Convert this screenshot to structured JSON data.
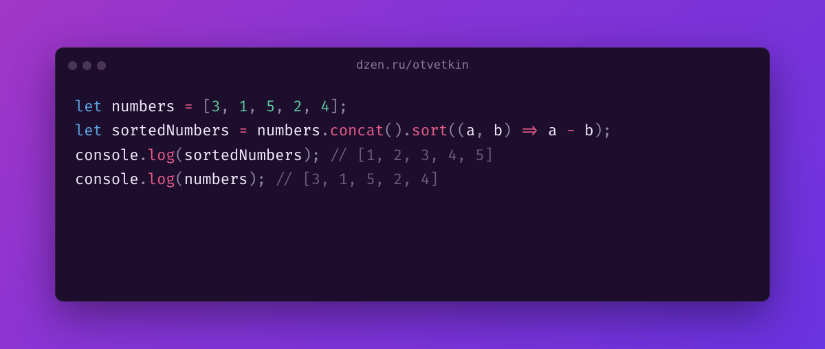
{
  "window": {
    "title": "dzen.ru/otvetkin"
  },
  "code": {
    "line1": {
      "kw": "let",
      "var": "numbers",
      "op": "=",
      "lb": "[",
      "n1": "3",
      "c1": ",",
      "n2": "1",
      "c2": ",",
      "n3": "5",
      "c3": ",",
      "n4": "2",
      "c4": ",",
      "n5": "4",
      "rb": "]",
      "semi": ";"
    },
    "line2": {
      "kw": "let",
      "var": "sortedNumbers",
      "op": "=",
      "obj": "numbers",
      "dot1": ".",
      "m1": "concat",
      "p1": "()",
      "dot2": ".",
      "m2": "sort",
      "lp": "((",
      "a": "a",
      "comma": ",",
      "b": "b",
      "rp": ")",
      "arrow": "=>",
      "av": "a",
      "minus": "-",
      "bv": "b",
      "rp2": ")",
      "semi": ";"
    },
    "line3": {
      "obj": "console",
      "dot": ".",
      "method": "log",
      "lp": "(",
      "arg": "sortedNumbers",
      "rp": ")",
      "semi": ";",
      "comment": "// [1, 2, 3, 4, 5]"
    },
    "line4": {
      "obj": "console",
      "dot": ".",
      "method": "log",
      "lp": "(",
      "arg": "numbers",
      "rp": ")",
      "semi": ";",
      "comment": "// [3, 1, 5, 2, 4]"
    }
  }
}
